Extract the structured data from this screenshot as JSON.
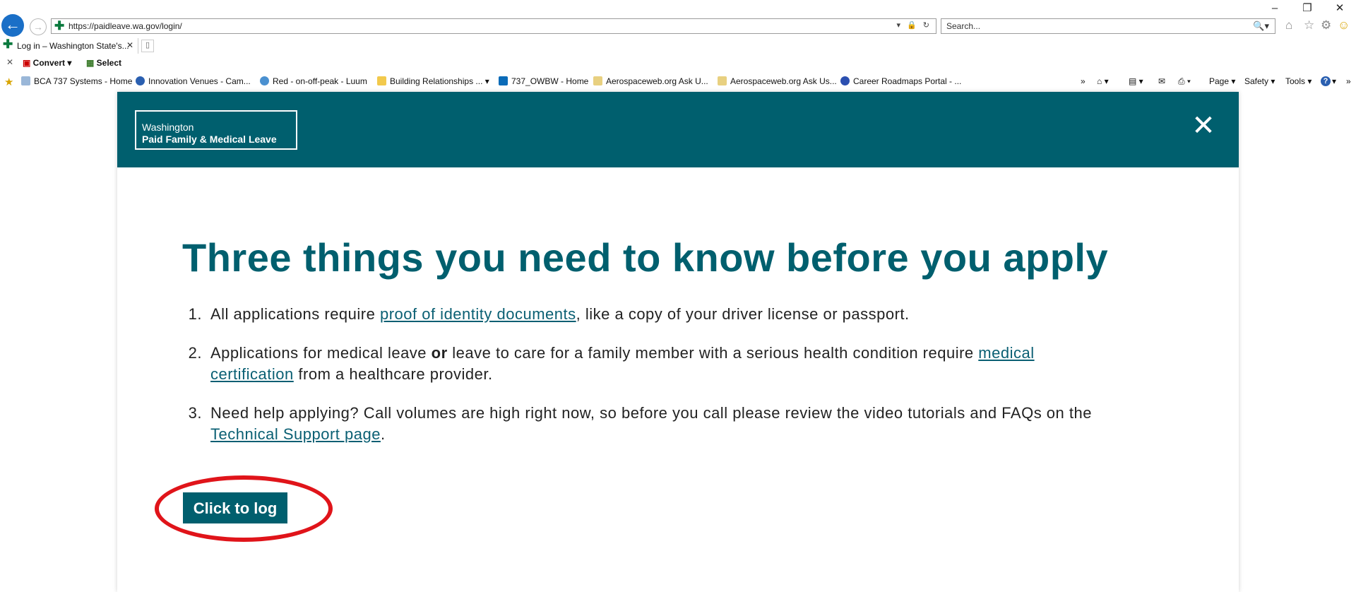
{
  "browser": {
    "window_controls": [
      "–",
      "❐",
      "✕"
    ],
    "address": {
      "url": "https://paidleave.wa.gov/login/",
      "tools": "▾ 🔒 ↻"
    },
    "search": {
      "placeholder": "Search...",
      "icon": "🔍▾"
    },
    "tab": {
      "title": "Log in – Washington State's...",
      "close": "✕"
    },
    "command_bar": {
      "close": "✕",
      "convert": "Convert",
      "select": "Select"
    },
    "favorites": [
      "BCA 737 Systems - Home",
      "Innovation Venues - Cam...",
      "Red - on-off-peak - Luum",
      "Building Relationships ...",
      "737_OWBW - Home",
      "Aerospaceweb.org  Ask U...",
      "Aerospaceweb.org Ask Us...",
      "Career Roadmaps Portal - ..."
    ],
    "toolbar": {
      "page": "Page ▾",
      "safety": "Safety ▾",
      "tools": "Tools ▾",
      "help": "?"
    }
  },
  "site": {
    "logo_line1": "Washington",
    "logo_line2": "Paid Family & Medical Leave",
    "close_symbol": "✕"
  },
  "main": {
    "headline": "Three things you need to know before you apply",
    "items": [
      {
        "num": "1.",
        "a": "All applications require ",
        "link": "proof of identity documents",
        "b": ", like a copy of your driver license or passport."
      },
      {
        "num": "2.",
        "a": "Applications for medical leave ",
        "bold": "or",
        "b": " leave to care for a family member with a serious health condition require ",
        "link": "medical certification",
        "c": " from a healthcare provider."
      },
      {
        "num": "3.",
        "a": "Need help applying? Call volumes are high right now, so before you call please review the video tutorials and FAQs on the ",
        "link": "Technical Support page",
        "b": "."
      }
    ],
    "login_button": "Click to log in"
  },
  "colors": {
    "brand_teal": "#005f6e",
    "annotation_red": "#e0141a",
    "link": "#0a5f73"
  }
}
